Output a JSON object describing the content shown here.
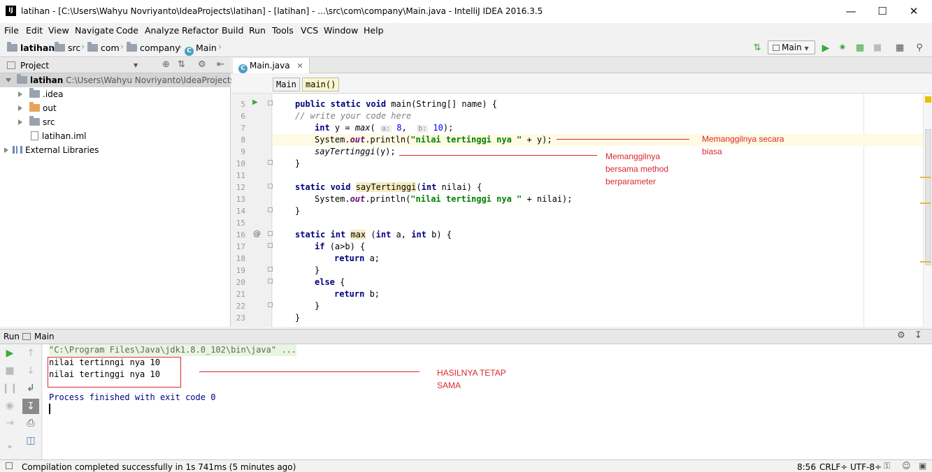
{
  "window": {
    "title": "latihan - [C:\\Users\\Wahyu Novriyanto\\IdeaProjects\\latihan] - [latihan] - ...\\src\\com\\company\\Main.java - IntelliJ IDEA 2016.3.5"
  },
  "menu": [
    "File",
    "Edit",
    "View",
    "Navigate",
    "Code",
    "Analyze",
    "Refactor",
    "Build",
    "Run",
    "Tools",
    "VCS",
    "Window",
    "Help"
  ],
  "breadcrumbs": [
    "latihan",
    "src",
    "com",
    "company",
    "Main"
  ],
  "toolbar": {
    "run_config": "Main"
  },
  "project": {
    "header": "Project",
    "root_name": "latihan",
    "root_path": "C:\\Users\\Wahyu Novriyanto\\IdeaProjects\\latihan",
    "items": [
      ".idea",
      "out",
      "src",
      "latihan.iml",
      "External Libraries"
    ]
  },
  "editor": {
    "tab": "Main.java",
    "structure": [
      "Main",
      "main()"
    ],
    "line_numbers": [
      "5",
      "6",
      "7",
      "8",
      "9",
      "10",
      "11",
      "12",
      "13",
      "14",
      "15",
      "16",
      "17",
      "18",
      "19",
      "20",
      "21",
      "22",
      "23"
    ]
  },
  "code": {
    "l5_kw": "public static void ",
    "l5_rest": "main(String[] name) {",
    "l6": "// write your code here",
    "l7_kw": "int ",
    "l7_a": "y = ",
    "l7_fn": "max",
    "l7_b": "( ",
    "l7_h1": "a:",
    "l7_n1": " 8",
    "l7_c": ",  ",
    "l7_h2": "b:",
    "l7_n2": " 10",
    "l7_d": ");",
    "l8_a": "System.",
    "l8_out": "out",
    "l8_b": ".println(",
    "l8_str": "\"nilai tertinggi nya \"",
    "l8_c": " + y);",
    "l9_fn": "sayTertinggi",
    "l9_rest": "(y);",
    "l10": "}",
    "l12_kw": "static void ",
    "l12_fn": "sayTertinggi",
    "l12_a": "(",
    "l12_kw2": "int ",
    "l12_b": "nilai) {",
    "l13_a": "System.",
    "l13_out": "out",
    "l13_b": ".println(",
    "l13_str": "\"nilai tertinggi nya \"",
    "l13_c": " + nilai);",
    "l14": "}",
    "l16_kw": "static int ",
    "l16_fn": "max",
    "l16_a": " (",
    "l16_kw2": "int ",
    "l16_b": "a, ",
    "l16_kw3": "int ",
    "l16_c": "b) {",
    "l17_kw": "if ",
    "l17_rest": "(a>b) {",
    "l18_kw": "return ",
    "l18_rest": "a;",
    "l19": "}",
    "l20_kw": "else ",
    "l20_rest": "{",
    "l21_kw": "return ",
    "l21_rest": "b;",
    "l22": "}",
    "l23": "}"
  },
  "annotations": {
    "a1_l1": "Memanggilnya secara",
    "a1_l2": "biasa",
    "a2_l1": "Memanggilnya",
    "a2_l2": "bersama method",
    "a2_l3": "berparameter",
    "a3_l1": "HASILNYA TETAP",
    "a3_l2": "SAMA"
  },
  "run": {
    "label": "Run",
    "config": "Main",
    "command": "\"C:\\Program Files\\Java\\jdk1.8.0_102\\bin\\java\" ...",
    "out1": "nilai tertinngi nya 10",
    "out2": "nilai tertinggi nya 10",
    "finished": "Process finished with exit code 0"
  },
  "status": {
    "message": "Compilation completed successfully in 1s 741ms (5 minutes ago)",
    "position": "8:56",
    "line_sep": "CRLF÷",
    "encoding": "UTF-8÷"
  },
  "colors": {
    "annotation": "#d9282e",
    "run_green": "#3aa83a"
  }
}
